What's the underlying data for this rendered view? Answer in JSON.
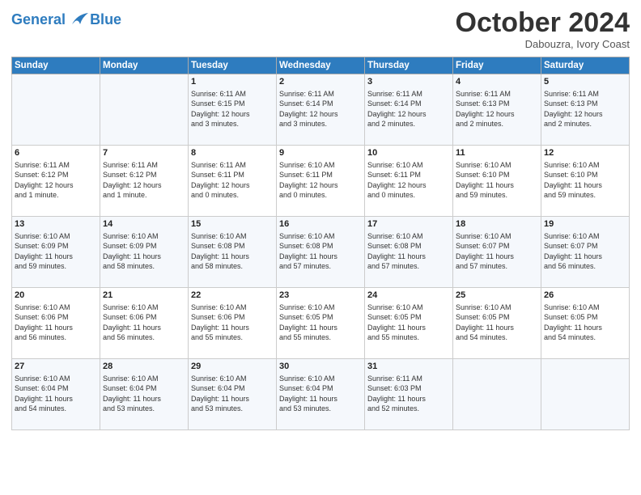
{
  "logo": {
    "line1": "General",
    "line2": "Blue"
  },
  "title": "October 2024",
  "subtitle": "Dabouzra, Ivory Coast",
  "header": {
    "colors": {
      "accent": "#2e7cbf"
    }
  },
  "weekdays": [
    "Sunday",
    "Monday",
    "Tuesday",
    "Wednesday",
    "Thursday",
    "Friday",
    "Saturday"
  ],
  "weeks": [
    [
      {
        "day": "",
        "content": ""
      },
      {
        "day": "",
        "content": ""
      },
      {
        "day": "1",
        "content": "Sunrise: 6:11 AM\nSunset: 6:15 PM\nDaylight: 12 hours\nand 3 minutes."
      },
      {
        "day": "2",
        "content": "Sunrise: 6:11 AM\nSunset: 6:14 PM\nDaylight: 12 hours\nand 3 minutes."
      },
      {
        "day": "3",
        "content": "Sunrise: 6:11 AM\nSunset: 6:14 PM\nDaylight: 12 hours\nand 2 minutes."
      },
      {
        "day": "4",
        "content": "Sunrise: 6:11 AM\nSunset: 6:13 PM\nDaylight: 12 hours\nand 2 minutes."
      },
      {
        "day": "5",
        "content": "Sunrise: 6:11 AM\nSunset: 6:13 PM\nDaylight: 12 hours\nand 2 minutes."
      }
    ],
    [
      {
        "day": "6",
        "content": "Sunrise: 6:11 AM\nSunset: 6:12 PM\nDaylight: 12 hours\nand 1 minute."
      },
      {
        "day": "7",
        "content": "Sunrise: 6:11 AM\nSunset: 6:12 PM\nDaylight: 12 hours\nand 1 minute."
      },
      {
        "day": "8",
        "content": "Sunrise: 6:11 AM\nSunset: 6:11 PM\nDaylight: 12 hours\nand 0 minutes."
      },
      {
        "day": "9",
        "content": "Sunrise: 6:10 AM\nSunset: 6:11 PM\nDaylight: 12 hours\nand 0 minutes."
      },
      {
        "day": "10",
        "content": "Sunrise: 6:10 AM\nSunset: 6:11 PM\nDaylight: 12 hours\nand 0 minutes."
      },
      {
        "day": "11",
        "content": "Sunrise: 6:10 AM\nSunset: 6:10 PM\nDaylight: 11 hours\nand 59 minutes."
      },
      {
        "day": "12",
        "content": "Sunrise: 6:10 AM\nSunset: 6:10 PM\nDaylight: 11 hours\nand 59 minutes."
      }
    ],
    [
      {
        "day": "13",
        "content": "Sunrise: 6:10 AM\nSunset: 6:09 PM\nDaylight: 11 hours\nand 59 minutes."
      },
      {
        "day": "14",
        "content": "Sunrise: 6:10 AM\nSunset: 6:09 PM\nDaylight: 11 hours\nand 58 minutes."
      },
      {
        "day": "15",
        "content": "Sunrise: 6:10 AM\nSunset: 6:08 PM\nDaylight: 11 hours\nand 58 minutes."
      },
      {
        "day": "16",
        "content": "Sunrise: 6:10 AM\nSunset: 6:08 PM\nDaylight: 11 hours\nand 57 minutes."
      },
      {
        "day": "17",
        "content": "Sunrise: 6:10 AM\nSunset: 6:08 PM\nDaylight: 11 hours\nand 57 minutes."
      },
      {
        "day": "18",
        "content": "Sunrise: 6:10 AM\nSunset: 6:07 PM\nDaylight: 11 hours\nand 57 minutes."
      },
      {
        "day": "19",
        "content": "Sunrise: 6:10 AM\nSunset: 6:07 PM\nDaylight: 11 hours\nand 56 minutes."
      }
    ],
    [
      {
        "day": "20",
        "content": "Sunrise: 6:10 AM\nSunset: 6:06 PM\nDaylight: 11 hours\nand 56 minutes."
      },
      {
        "day": "21",
        "content": "Sunrise: 6:10 AM\nSunset: 6:06 PM\nDaylight: 11 hours\nand 56 minutes."
      },
      {
        "day": "22",
        "content": "Sunrise: 6:10 AM\nSunset: 6:06 PM\nDaylight: 11 hours\nand 55 minutes."
      },
      {
        "day": "23",
        "content": "Sunrise: 6:10 AM\nSunset: 6:05 PM\nDaylight: 11 hours\nand 55 minutes."
      },
      {
        "day": "24",
        "content": "Sunrise: 6:10 AM\nSunset: 6:05 PM\nDaylight: 11 hours\nand 55 minutes."
      },
      {
        "day": "25",
        "content": "Sunrise: 6:10 AM\nSunset: 6:05 PM\nDaylight: 11 hours\nand 54 minutes."
      },
      {
        "day": "26",
        "content": "Sunrise: 6:10 AM\nSunset: 6:05 PM\nDaylight: 11 hours\nand 54 minutes."
      }
    ],
    [
      {
        "day": "27",
        "content": "Sunrise: 6:10 AM\nSunset: 6:04 PM\nDaylight: 11 hours\nand 54 minutes."
      },
      {
        "day": "28",
        "content": "Sunrise: 6:10 AM\nSunset: 6:04 PM\nDaylight: 11 hours\nand 53 minutes."
      },
      {
        "day": "29",
        "content": "Sunrise: 6:10 AM\nSunset: 6:04 PM\nDaylight: 11 hours\nand 53 minutes."
      },
      {
        "day": "30",
        "content": "Sunrise: 6:10 AM\nSunset: 6:04 PM\nDaylight: 11 hours\nand 53 minutes."
      },
      {
        "day": "31",
        "content": "Sunrise: 6:11 AM\nSunset: 6:03 PM\nDaylight: 11 hours\nand 52 minutes."
      },
      {
        "day": "",
        "content": ""
      },
      {
        "day": "",
        "content": ""
      }
    ]
  ]
}
